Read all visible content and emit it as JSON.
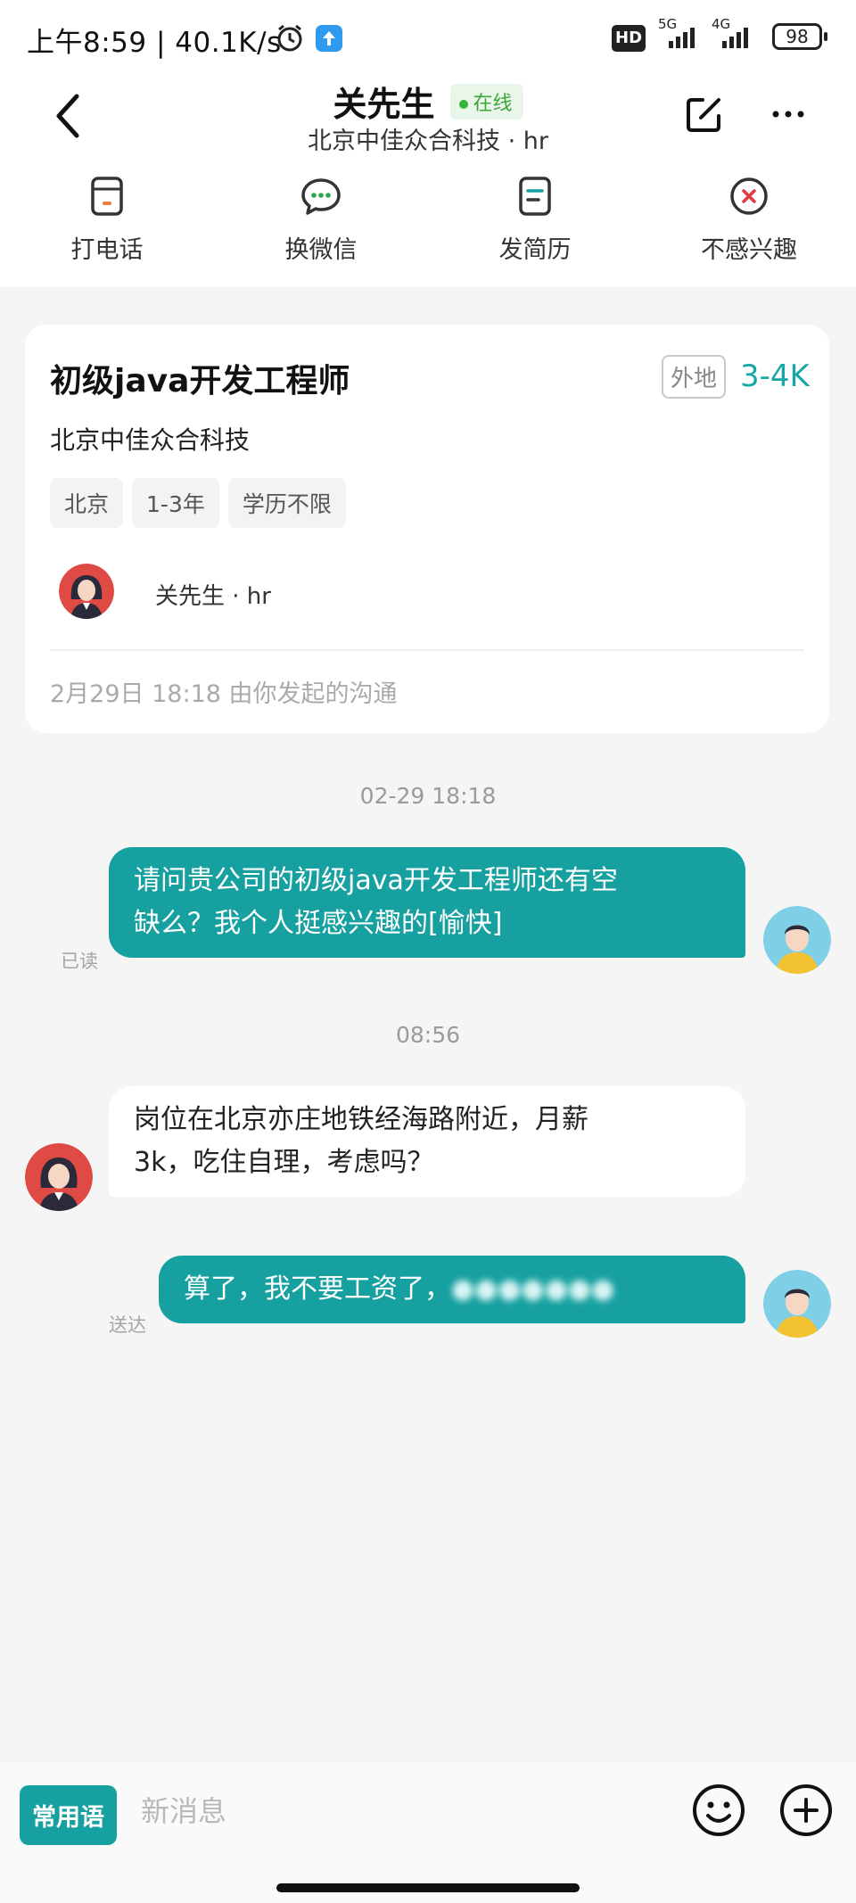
{
  "status_bar": {
    "time": "上午8:59",
    "speed": "40.1K/s",
    "hd_label": "HD",
    "net_1": "5G",
    "net_2": "4G",
    "battery": "98"
  },
  "header": {
    "name": "关先生",
    "online_label": "在线",
    "subtitle": "北京中佳众合科技 · hr"
  },
  "actions": [
    {
      "label": "打电话",
      "icon": "phone-icon"
    },
    {
      "label": "换微信",
      "icon": "wechat-icon"
    },
    {
      "label": "发简历",
      "icon": "resume-icon"
    },
    {
      "label": "不感兴趣",
      "icon": "not-interested-icon"
    }
  ],
  "job_card": {
    "title": "初级java开发工程师",
    "location_tag": "外地",
    "salary": "3-4K",
    "company": "北京中佳众合科技",
    "tags": [
      "北京",
      "1-3年",
      "学历不限"
    ],
    "hr_label": "关先生 · hr",
    "footer": "2月29日 18:18 由你发起的沟通"
  },
  "chat": {
    "timestamp_1": "02-29 18:18",
    "msg_1_line1": "请问贵公司的初级java开发工程师还有空",
    "msg_1_line2": "缺么？我个人挺感兴趣的[愉快]",
    "msg_1_state": "已读",
    "timestamp_2": "08:56",
    "msg_2_line1": "岗位在北京亦庄地铁经海路附近，月薪",
    "msg_2_line2": "3k，吃住自理，考虑吗？",
    "msg_3_text": "算了，我不要工资了，",
    "msg_3_blurred": "●●●●●●●",
    "msg_3_state": "送达"
  },
  "input_bar": {
    "phrases_label": "常用语",
    "placeholder": "新消息"
  },
  "colors": {
    "accent": "#17a0a0",
    "online": "#37b537",
    "background": "#f5f5f5"
  }
}
